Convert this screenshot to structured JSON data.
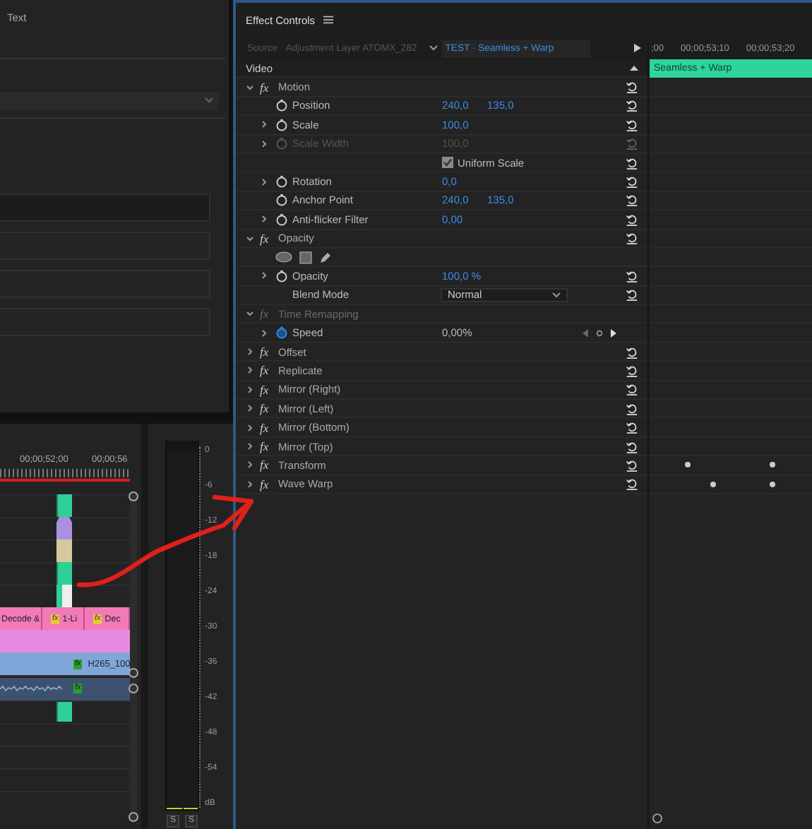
{
  "left_panel": {
    "title": "Text"
  },
  "timeline": {
    "ruler": [
      "00;00;52;00",
      "00;00;56"
    ],
    "clips": [
      {
        "label": "Decode &"
      },
      {
        "label": "1-Li",
        "badge": "fx"
      },
      {
        "label": "Dec",
        "badge": "fx"
      }
    ],
    "video_clip": {
      "label": "H265_100",
      "badge": "fx"
    },
    "audio_clip": {
      "badge": "fx"
    }
  },
  "audio_meter": {
    "scale": [
      "0",
      "-6",
      "-12",
      "-18",
      "-24",
      "-30",
      "-36",
      "-42",
      "-48",
      "-54",
      "dB"
    ],
    "solo_buttons": [
      "S",
      "S"
    ]
  },
  "effect_controls": {
    "title": "Effect Controls",
    "tabs": [
      {
        "label": "Source · Adjustment Layer ATOMX_282",
        "selected": false
      },
      {
        "label": "TEST · Seamless + Warp",
        "selected": true
      }
    ],
    "ruler": [
      ";00",
      "00;00;53;10",
      "00;00;53;20"
    ],
    "clip_label": "Seamless + Warp",
    "rows": [
      {
        "kind": "section",
        "label": "Video"
      },
      {
        "kind": "effect",
        "badge": "fx",
        "label": "Motion",
        "expanded": true,
        "disabled": false,
        "reset": true,
        "keyframes": false
      },
      {
        "kind": "property",
        "label": "Position",
        "expandable": false,
        "values": [
          "240,0",
          "135,0"
        ],
        "disabled": false,
        "animated": false,
        "reset": true
      },
      {
        "kind": "property",
        "label": "Scale",
        "expandable": true,
        "values": [
          "100,0"
        ],
        "disabled": false,
        "animated": false,
        "reset": true
      },
      {
        "kind": "property",
        "label": "Scale Width",
        "expandable": true,
        "values": [
          "100,0"
        ],
        "disabled": true,
        "animated": false,
        "reset": true
      },
      {
        "kind": "checkbox",
        "label": "Uniform Scale",
        "checked": true,
        "reset": true
      },
      {
        "kind": "property",
        "label": "Rotation",
        "expandable": true,
        "values": [
          "0,0"
        ],
        "disabled": false,
        "animated": false,
        "reset": true
      },
      {
        "kind": "property",
        "label": "Anchor Point",
        "expandable": false,
        "values": [
          "240,0",
          "135,0"
        ],
        "disabled": false,
        "animated": false,
        "reset": true
      },
      {
        "kind": "property",
        "label": "Anti-flicker Filter",
        "expandable": true,
        "values": [
          "0,00"
        ],
        "disabled": false,
        "animated": false,
        "reset": true
      },
      {
        "kind": "effect",
        "badge": "fx",
        "label": "Opacity",
        "expanded": true,
        "disabled": false,
        "reset": true,
        "keyframes": false
      },
      {
        "kind": "mask_tools"
      },
      {
        "kind": "property",
        "label": "Opacity",
        "expandable": true,
        "values": [
          "100,0 %"
        ],
        "disabled": false,
        "animated": false,
        "reset": true
      },
      {
        "kind": "dropdown",
        "label": "Blend Mode",
        "value": "Normal",
        "reset": true
      },
      {
        "kind": "effect",
        "badge": "fx",
        "label": "Time Remapping",
        "expanded": true,
        "disabled": true,
        "reset": false,
        "keyframes": false
      },
      {
        "kind": "property",
        "label": "Speed",
        "expandable": true,
        "values": [
          "0,00%"
        ],
        "disabled": false,
        "animated": true,
        "reset": false
      },
      {
        "kind": "effect",
        "badge": "fx",
        "label": "Offset",
        "expanded": false,
        "disabled": false,
        "reset": true,
        "keyframes": false
      },
      {
        "kind": "effect",
        "badge": "fx",
        "label": "Replicate",
        "expanded": false,
        "disabled": false,
        "reset": true,
        "keyframes": false
      },
      {
        "kind": "effect",
        "badge": "fx",
        "label": "Mirror (Right)",
        "expanded": false,
        "disabled": false,
        "reset": true,
        "keyframes": false
      },
      {
        "kind": "effect",
        "badge": "fx",
        "label": "Mirror (Left)",
        "expanded": false,
        "disabled": false,
        "reset": true,
        "keyframes": false
      },
      {
        "kind": "effect",
        "badge": "fx",
        "label": "Mirror (Bottom)",
        "expanded": false,
        "disabled": false,
        "reset": true,
        "keyframes": false
      },
      {
        "kind": "effect",
        "badge": "fx",
        "label": "Mirror (Top)",
        "expanded": false,
        "disabled": false,
        "reset": true,
        "keyframes": false
      },
      {
        "kind": "effect",
        "badge": "fx",
        "label": "Transform",
        "expanded": false,
        "disabled": false,
        "reset": true,
        "keyframes": true
      },
      {
        "kind": "effect",
        "badge": "fx",
        "label": "Wave Warp",
        "expanded": false,
        "disabled": false,
        "reset": true,
        "keyframes": true
      }
    ]
  }
}
